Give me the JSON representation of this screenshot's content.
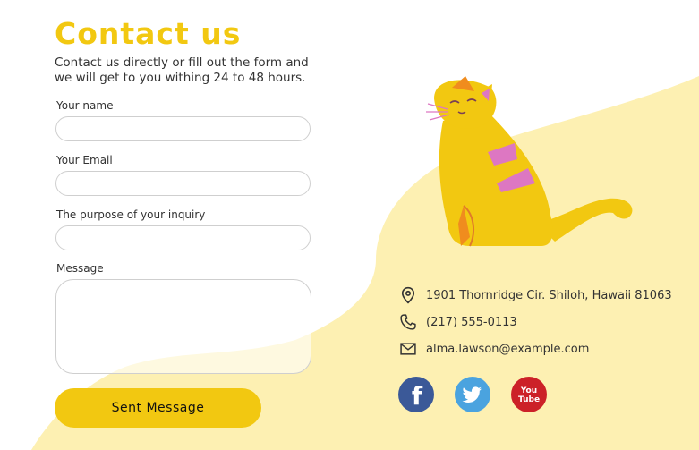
{
  "page": {
    "title": "Contact us",
    "subtitle": "Contact us directly or fill out the form and we will get to you withing 24 to 48 hours."
  },
  "form": {
    "name_label": "Your name",
    "name_value": "",
    "email_label": "Your Email",
    "email_value": "",
    "purpose_label": "The purpose of your inquiry",
    "purpose_value": "",
    "message_label": "Message",
    "message_value": "",
    "submit_label": "Sent Message"
  },
  "contact": {
    "address": "1901 Thornridge Cir. Shiloh, Hawaii 81063",
    "phone": "(217) 555-0113",
    "email": "alma.lawson@example.com"
  },
  "social": {
    "facebook_letter": "f",
    "youtube_top": "You",
    "youtube_bottom": "Tube"
  },
  "colors": {
    "accent": "#f2c811",
    "background_blob": "#fdf0b2",
    "facebook": "#3b5998",
    "twitter": "#4aa3df",
    "youtube": "#cc2128",
    "cat_stripes": "#dd77c2"
  },
  "icons": {
    "address": "location-pin-icon",
    "phone": "phone-icon",
    "email": "envelope-icon",
    "facebook": "facebook-icon",
    "twitter": "twitter-icon",
    "youtube": "youtube-icon"
  }
}
